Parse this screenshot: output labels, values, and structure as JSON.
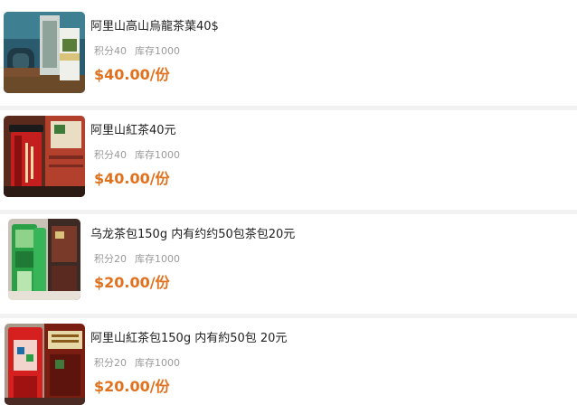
{
  "products": [
    {
      "title": "阿里山高山烏龍茶葉40$",
      "points": "积分40",
      "stock": "库存1000",
      "price": "$40.00/份",
      "image_icon": "tea-tin-photo"
    },
    {
      "title": "阿里山紅茶40元",
      "points": "积分40",
      "stock": "库存1000",
      "price": "$40.00/份",
      "image_icon": "black-tea-can-photo"
    },
    {
      "title": "乌龙茶包150g 内有约约50包茶包20元",
      "points": "积分20",
      "stock": "库存1000",
      "price": "$20.00/份",
      "image_icon": "oolong-teabag-pack-photo"
    },
    {
      "title": "阿里山紅茶包150g 内有約50包 20元",
      "points": "积分20",
      "stock": "库存1000",
      "price": "$20.00/份",
      "image_icon": "black-teabag-pack-photo"
    }
  ],
  "colors": {
    "price": "#e2711d",
    "meta": "#9a9a9a",
    "title": "#1f1f1f",
    "separator": "#f2f2f2"
  }
}
